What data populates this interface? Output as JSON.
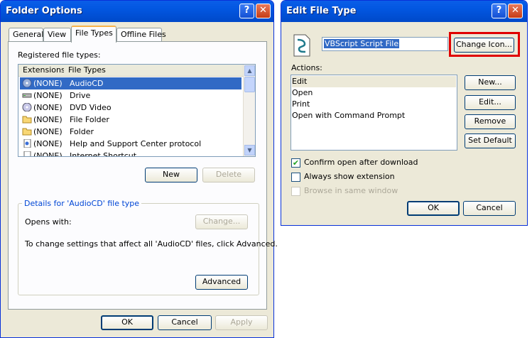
{
  "folder_options": {
    "title": "Folder Options",
    "tabs": [
      "General",
      "View",
      "File Types",
      "Offline Files"
    ],
    "registered_label": "Registered file types:",
    "columns": [
      "Extensions",
      "File Types"
    ],
    "rows": [
      {
        "ext": "(NONE)",
        "type": "AudioCD",
        "icon": "audio-cd-icon"
      },
      {
        "ext": "(NONE)",
        "type": "Drive",
        "icon": "drive-icon"
      },
      {
        "ext": "(NONE)",
        "type": "DVD Video",
        "icon": "dvd-icon"
      },
      {
        "ext": "(NONE)",
        "type": "File Folder",
        "icon": "folder-icon"
      },
      {
        "ext": "(NONE)",
        "type": "Folder",
        "icon": "folder-icon"
      },
      {
        "ext": "(NONE)",
        "type": "Help and Support Center protocol",
        "icon": "document-icon"
      },
      {
        "ext": "(NONE)",
        "type": "Internet Shortcut",
        "icon": "shortcut-icon"
      }
    ],
    "new_label": "New",
    "delete_label": "Delete",
    "details_title": "Details for 'AudioCD' file type",
    "opens_with": "Opens with:",
    "change_label": "Change...",
    "advanced_text": "To change settings that affect all 'AudioCD' files, click Advanced.",
    "advanced_label": "Advanced",
    "ok_label": "OK",
    "cancel_label": "Cancel",
    "apply_label": "Apply"
  },
  "edit_file_type": {
    "title": "Edit File Type",
    "name_value": "VBScript Script File",
    "change_icon_label": "Change Icon...",
    "actions_label": "Actions:",
    "actions": [
      "Edit",
      "Open",
      "Print",
      "Open with Command Prompt"
    ],
    "new_label": "New...",
    "edit_label": "Edit...",
    "remove_label": "Remove",
    "set_default_label": "Set Default",
    "confirm_open": "Confirm open after download",
    "always_show": "Always show extension",
    "browse_same": "Browse in same window",
    "ok_label": "OK",
    "cancel_label": "Cancel"
  },
  "titlebar_buttons": {
    "help": "?",
    "close": "✕"
  },
  "colors": {
    "highlight": "#e00000",
    "selection": "#316ac5",
    "titlebar": "#0054e3"
  }
}
